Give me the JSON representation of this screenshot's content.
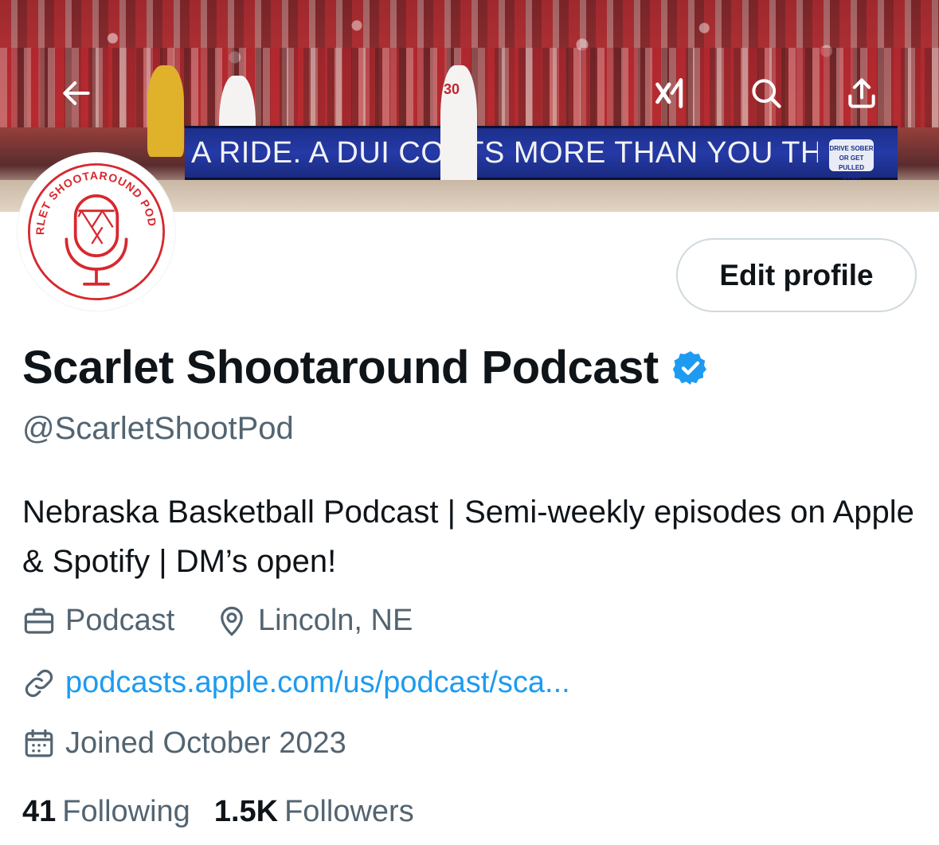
{
  "header": {
    "banner_board_text": "A RIDE. A DUI COSTS MORE THAN YOU THINK.",
    "banner_board_badge": "DRIVE SOBER OR GET PULLED OVER",
    "jersey_number": "30",
    "back_icon": "arrow-left-icon",
    "grok_icon": "grok-icon",
    "search_icon": "search-icon",
    "share_icon": "share-icon"
  },
  "avatar": {
    "ring_text": "SCARLET SHOOTAROUND PODCAST",
    "accent_color": "#d7282f"
  },
  "profile": {
    "edit_label": "Edit profile",
    "display_name": "Scarlet Shootaround Podcast",
    "verified": true,
    "verified_color": "#1d9bf0",
    "handle": "@ScarletShootPod",
    "bio": "Nebraska Basketball Podcast | Semi-weekly episodes on Apple & Spotify | DM’s open!",
    "category": "Podcast",
    "location": "Lincoln, NE",
    "website": "podcasts.apple.com/us/podcast/sca...",
    "joined": "Joined October 2023"
  },
  "stats": {
    "following_count": "41",
    "following_label": "Following",
    "followers_count": "1.5K",
    "followers_label": "Followers"
  },
  "colors": {
    "text_primary": "#0f1419",
    "text_secondary": "#536471",
    "link": "#1d9bf0"
  }
}
